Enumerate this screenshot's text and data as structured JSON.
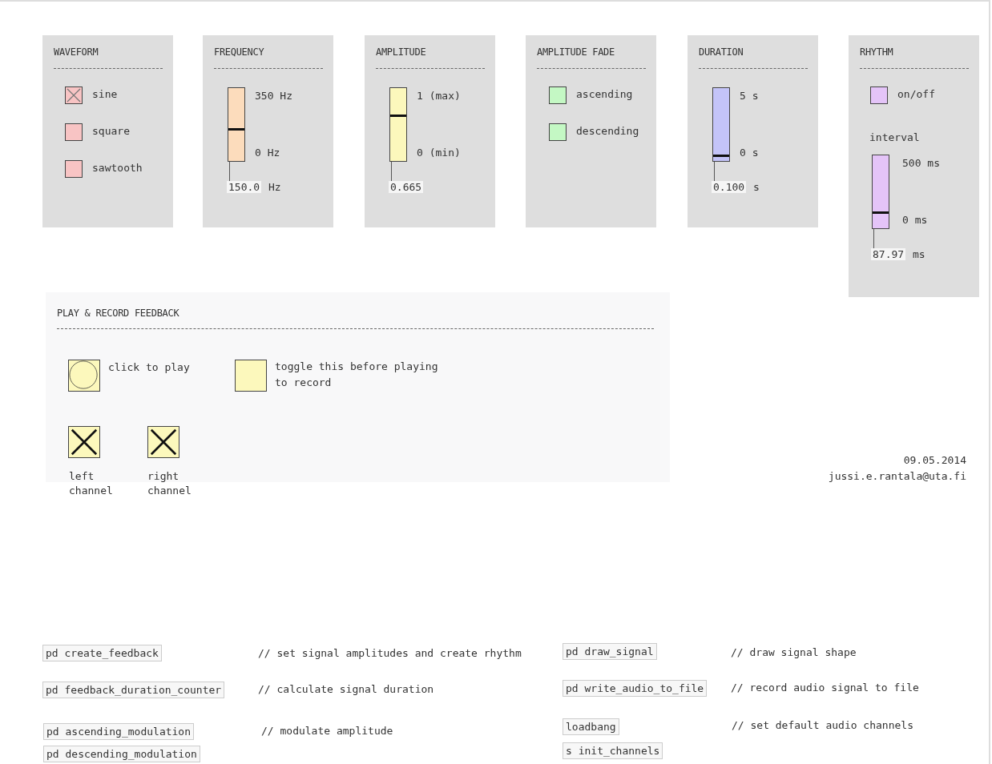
{
  "panels": [
    {
      "kind": "toggles",
      "title": "WAVEFORM",
      "color": "#f8c4c4",
      "options": [
        {
          "label": "sine",
          "checked": true
        },
        {
          "label": "square",
          "checked": false
        },
        {
          "label": "sawtooth",
          "checked": false
        }
      ]
    },
    {
      "kind": "slider",
      "title": "FREQUENCY",
      "color": "#fcdcbc",
      "slider": {
        "max_label": "350 Hz",
        "min_label": "0 Hz",
        "level": 0.43,
        "value": "150.0",
        "unit": "Hz"
      }
    },
    {
      "kind": "slider",
      "title": "AMPLITUDE",
      "color": "#fcf8bc",
      "slider": {
        "max_label": "1 (max)",
        "min_label": "0 (min)",
        "level": 0.63,
        "value": "0.665"
      }
    },
    {
      "kind": "toggles",
      "title": "AMPLITUDE FADE",
      "color": "#c4f8c4",
      "options": [
        {
          "label": "ascending",
          "checked": false
        },
        {
          "label": "descending",
          "checked": false
        }
      ]
    },
    {
      "kind": "slider",
      "title": "DURATION",
      "color": "#c4c4f8",
      "slider": {
        "max_label": "5 s",
        "min_label": "0 s",
        "level": 0.06,
        "value": "0.100",
        "unit": "s"
      }
    },
    {
      "kind": "rhythm",
      "title": "RHYTHM",
      "color": "#e4c4f8",
      "options": [
        {
          "label": "on/off",
          "checked": false
        }
      ],
      "interval_label": "interval",
      "slider": {
        "max_label": "500 ms",
        "min_label": "0 ms",
        "level": 0.2,
        "value": "87.97",
        "unit": "ms"
      }
    }
  ],
  "feedback": {
    "title": "PLAY & RECORD FEEDBACK",
    "play": {
      "label": "click to play"
    },
    "record": {
      "label": "toggle this before playing to record",
      "checked": false
    },
    "channels": [
      {
        "label": "left channel",
        "checked": true
      },
      {
        "label": "right channel",
        "checked": true
      }
    ]
  },
  "signature": {
    "date": "09.05.2014",
    "email": "jussi.e.rantala@uta.fi"
  },
  "objects": [
    {
      "text": "pd create_feedback"
    },
    {
      "text": "pd feedback_duration_counter"
    },
    {
      "text": "pd ascending_modulation"
    },
    {
      "text": "pd descending_modulation"
    },
    {
      "text": "pd draw_signal"
    },
    {
      "text": "pd write_audio_to_file"
    },
    {
      "text": "loadbang"
    },
    {
      "text": "s init_channels"
    }
  ],
  "comments": [
    {
      "text": "// set signal amplitudes and create rhythm"
    },
    {
      "text": "// calculate signal duration"
    },
    {
      "text": "// modulate amplitude"
    },
    {
      "text": "// draw signal shape"
    },
    {
      "text": "// record audio signal to file"
    },
    {
      "text": "// set default audio channels"
    }
  ]
}
